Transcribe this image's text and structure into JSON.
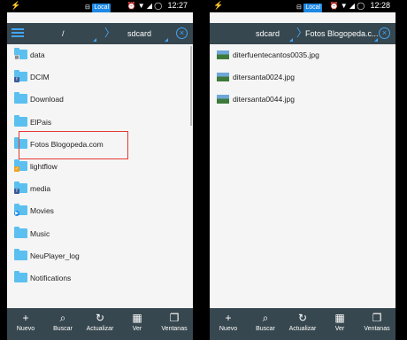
{
  "left": {
    "status": {
      "badge": "Local",
      "time": "12:27"
    },
    "toolbar": {
      "crumb1": "/",
      "crumb2": "sdcard"
    },
    "items": [
      {
        "label": "data",
        "icon": "folder-data"
      },
      {
        "label": "DCIM",
        "icon": "folder-facebook"
      },
      {
        "label": "Download",
        "icon": "folder"
      },
      {
        "label": "ElPais",
        "icon": "folder"
      },
      {
        "label": "Fotos Blogopeda.com",
        "icon": "folder"
      },
      {
        "label": "lightflow",
        "icon": "folder-app"
      },
      {
        "label": "media",
        "icon": "folder-facebook"
      },
      {
        "label": "Movies",
        "icon": "folder-play"
      },
      {
        "label": "Music",
        "icon": "folder"
      },
      {
        "label": "NeuPlayer_log",
        "icon": "folder"
      },
      {
        "label": "Notifications",
        "icon": "folder"
      }
    ]
  },
  "right": {
    "status": {
      "badge": "Local",
      "time": "12:28"
    },
    "toolbar": {
      "crumb1": "sdcard",
      "crumb2": "Fotos Blogopeda.c..."
    },
    "items": [
      {
        "label": "diterfuentecantos0035.jpg"
      },
      {
        "label": "ditersanta0024.jpg"
      },
      {
        "label": "ditersanta0044.jpg"
      }
    ]
  },
  "bottom": {
    "nuevo": "Nuevo",
    "buscar": "Buscar",
    "actualizar": "Actualizar",
    "ver": "Ver",
    "ventanas": "Ventanas"
  },
  "colors": {
    "toolbar": "#37474f",
    "accent": "#42a5f5",
    "folder": "#5bc0ef",
    "highlight": "#e53935"
  }
}
